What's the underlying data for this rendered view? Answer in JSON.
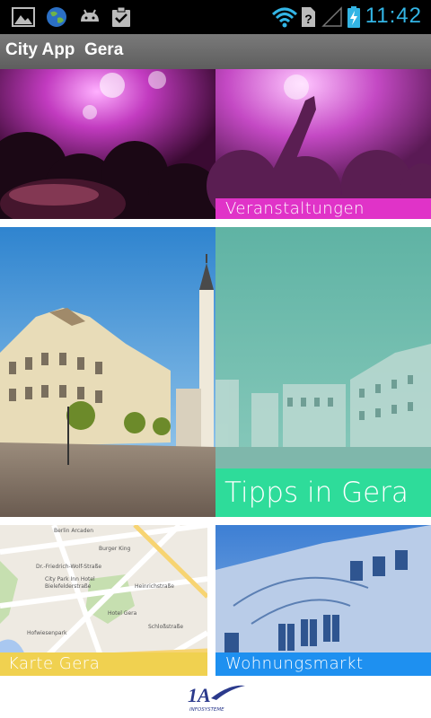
{
  "status_bar": {
    "time": "11:42",
    "icons": [
      "picture-icon",
      "globe-icon",
      "android-icon",
      "clipboard-check-icon",
      "wifi-icon",
      "no-signal-icon",
      "battery-charging-icon"
    ]
  },
  "action_bar": {
    "title": "City App  Gera"
  },
  "tiles": {
    "events": {
      "label": "Veranstaltungen",
      "color": "#e033c8"
    },
    "tips": {
      "label": "Tipps in Gera",
      "color": "#2edc9a"
    },
    "map": {
      "label": "Karte Gera",
      "color": "#f0d150"
    },
    "housing": {
      "label": "Wohnungsmarkt",
      "color": "#1e90f0"
    }
  },
  "map_labels": [
    "Berlin Arcaden",
    "Burger King",
    "Dr.-Friedrich-Wolf-Straße",
    "City Park Inn Hotel",
    "Bielefelderstraße",
    "Hotel Gera",
    "Heinrichstraße",
    "Hofwiesenpark",
    "Schloßstraße"
  ],
  "footer": {
    "logo_text": "1A",
    "logo_subtext": "INFOSYSTEME"
  }
}
